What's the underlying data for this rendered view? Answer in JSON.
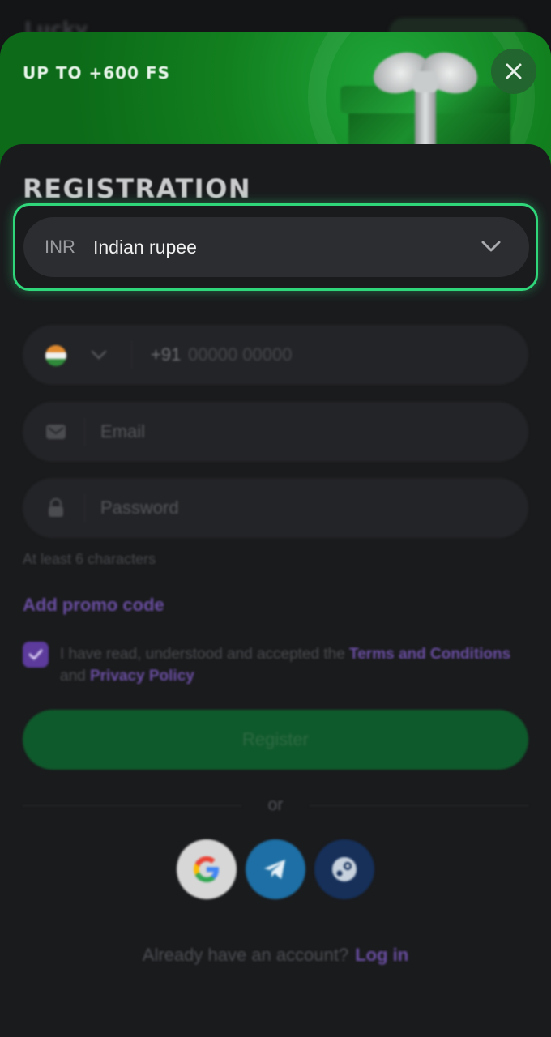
{
  "header": {
    "logo_text": "Lucky"
  },
  "banner": {
    "title": "UP TO +600 FS"
  },
  "registration": {
    "title": "REGISTRATION",
    "currency": {
      "code": "INR",
      "name": "Indian rupee"
    },
    "phone": {
      "country_code": "+91",
      "placeholder": "00000 00000"
    },
    "email": {
      "placeholder": "Email"
    },
    "password": {
      "placeholder": "Password",
      "hint": "At least 6 characters"
    },
    "promo_link": "Add promo code",
    "terms": {
      "checked": true,
      "prefix": "I have read, understood and accepted the ",
      "terms_link": "Terms and Conditions",
      "middle": " and ",
      "privacy_link": "Privacy Policy"
    },
    "register_button": "Register",
    "or_text": "or",
    "social": [
      "google-icon",
      "telegram-icon",
      "steam-icon"
    ],
    "login_prompt": "Already have an account?",
    "login_link": "Log in"
  },
  "colors": {
    "highlight": "#2fd67a",
    "banner_green": "#12801f",
    "link_purple": "#6b4fa3",
    "register_green": "#0f5a2c"
  }
}
